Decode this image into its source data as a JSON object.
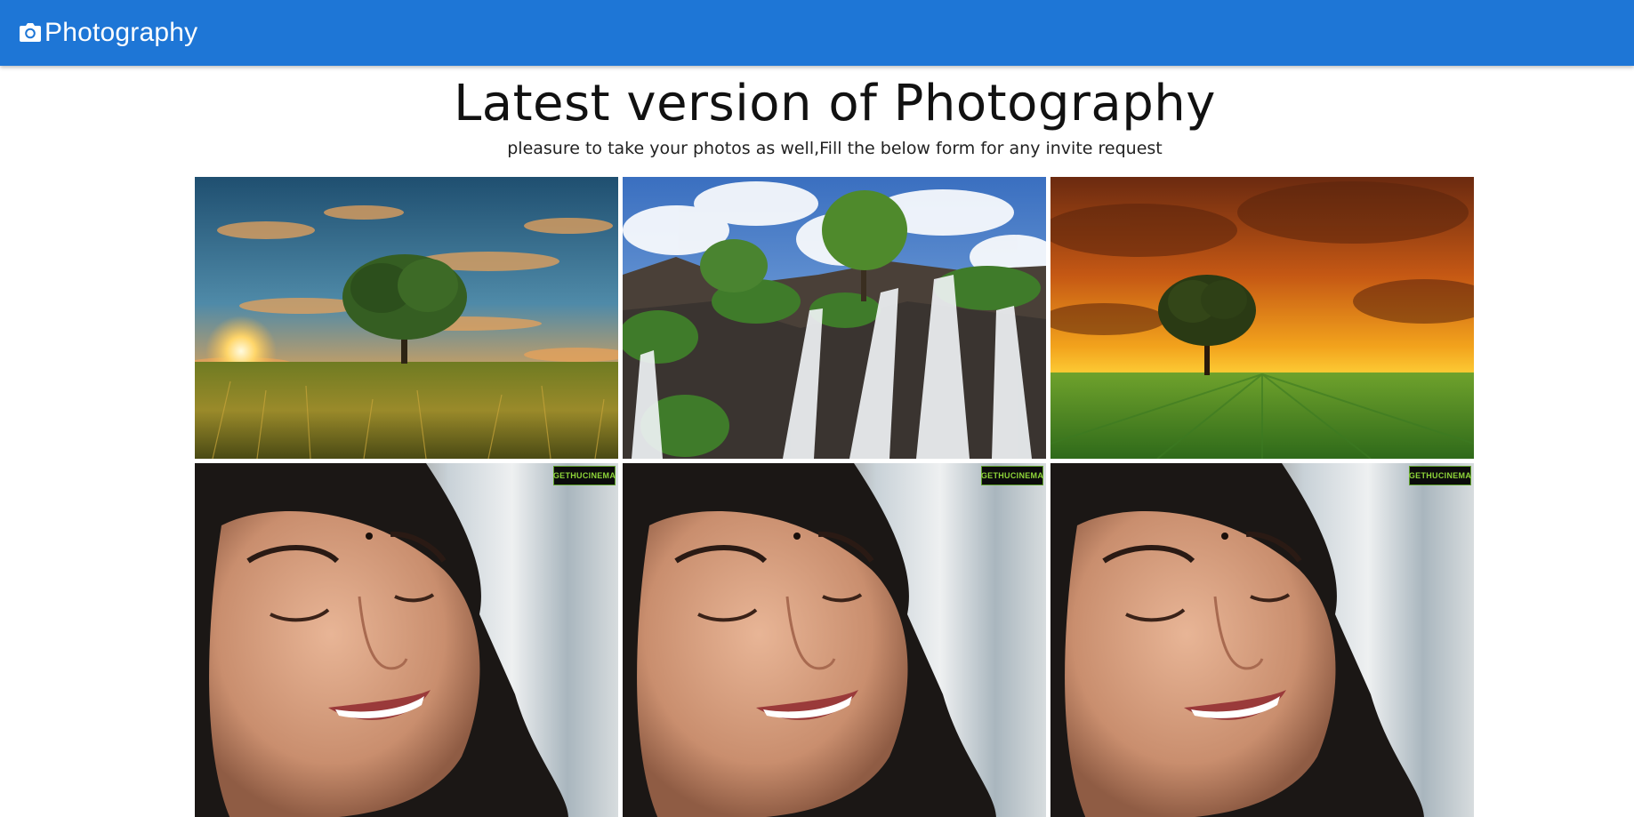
{
  "navbar": {
    "brand_label": "Photography",
    "brand_icon": "camera-icon",
    "color": "#1e76d6"
  },
  "hero": {
    "title": "Latest version of Photography",
    "subtitle": "pleasure to take your photos as well,Fill the below form for any invite request"
  },
  "gallery": {
    "photos": [
      {
        "subject": "tree-sunset-wheat-field"
      },
      {
        "subject": "waterfall-rocks-sky"
      },
      {
        "subject": "tree-orange-sky-green-field"
      },
      {
        "subject": "smiling-woman-portrait",
        "watermark": "GETHUCINEMA"
      },
      {
        "subject": "smiling-woman-portrait",
        "watermark": "GETHUCINEMA"
      },
      {
        "subject": "smiling-woman-portrait",
        "watermark": "GETHUCINEMA"
      }
    ]
  }
}
